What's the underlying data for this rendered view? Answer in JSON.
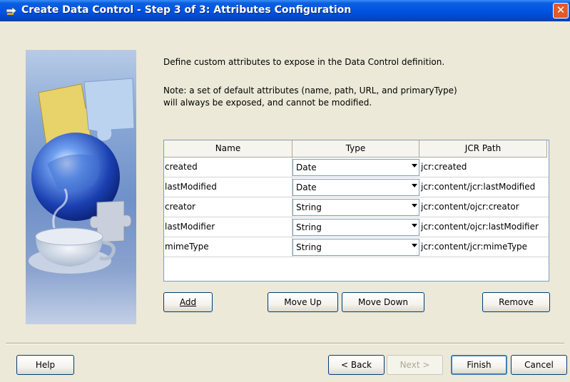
{
  "window": {
    "title": "Create Data Control - Step 3 of 3: Attributes Configuration",
    "title_icon": "duke-arrow-icon",
    "close_label": "✕"
  },
  "content": {
    "description": "Define custom attributes to expose in the Data Control definition.",
    "note_line1": "Note: a set of default attributes (name, path, URL, and primaryType)",
    "note_line2": "will always be exposed, and cannot be modified."
  },
  "table": {
    "columns": [
      "Name",
      "Type",
      "JCR Path"
    ],
    "rows": [
      {
        "name": "created",
        "type": "Date",
        "path": "jcr:created"
      },
      {
        "name": "lastModified",
        "type": "Date",
        "path": "jcr:content/jcr:lastModified"
      },
      {
        "name": "creator",
        "type": "String",
        "path": "jcr:content/ojcr:creator"
      },
      {
        "name": "lastModifier",
        "type": "String",
        "path": "jcr:content/ojcr:lastModifier"
      },
      {
        "name": "mimeType",
        "type": "String",
        "path": "jcr:content/jcr:mimeType"
      }
    ]
  },
  "buttons": {
    "add": "Add",
    "move_up": "Move Up",
    "move_down": "Move Down",
    "remove": "Remove",
    "help": "Help",
    "back": "< Back",
    "next": "Next >",
    "finish": "Finish",
    "cancel": "Cancel"
  },
  "colors": {
    "title_bar": "#0054e3",
    "dialog_bg": "#ece9d8",
    "close_button": "#e35a2a"
  }
}
